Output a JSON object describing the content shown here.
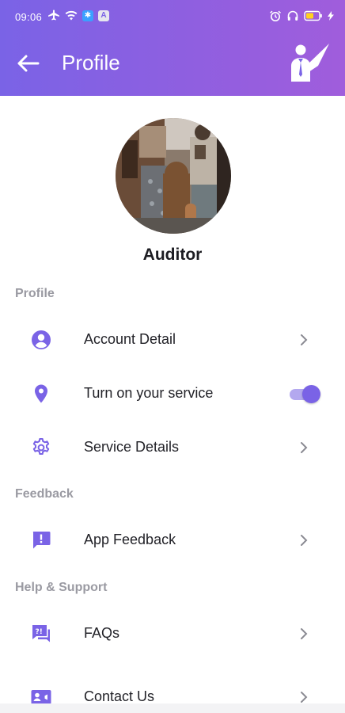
{
  "status_bar": {
    "time": "09:06",
    "left_icons": [
      "airplane-icon",
      "wifi-icon",
      "bluetooth-badge-icon",
      "app-badge-icon"
    ],
    "right_icons": [
      "alarm-icon",
      "headphones-icon",
      "battery-icon",
      "charging-icon"
    ]
  },
  "toolbar": {
    "title": "Profile",
    "back_icon": "arrow-left-icon",
    "logo_icon": "auditor-logo-icon"
  },
  "profile": {
    "name": "Auditor"
  },
  "sections": {
    "profile": "Profile",
    "feedback": "Feedback",
    "help": "Help & Support"
  },
  "items": {
    "account_detail": "Account Detail",
    "turn_on_service": "Turn on your service",
    "service_details": "Service Details",
    "app_feedback": "App Feedback",
    "faqs": "FAQs",
    "contact_us": "Contact Us"
  },
  "service_toggle": {
    "on": true
  },
  "colors": {
    "accent": "#7a63e6",
    "header_gradient_start": "#7a63e6",
    "header_gradient_end": "#a05ddc",
    "section_label": "#9a9aa2",
    "toggle_track": "#b3a8ef"
  }
}
